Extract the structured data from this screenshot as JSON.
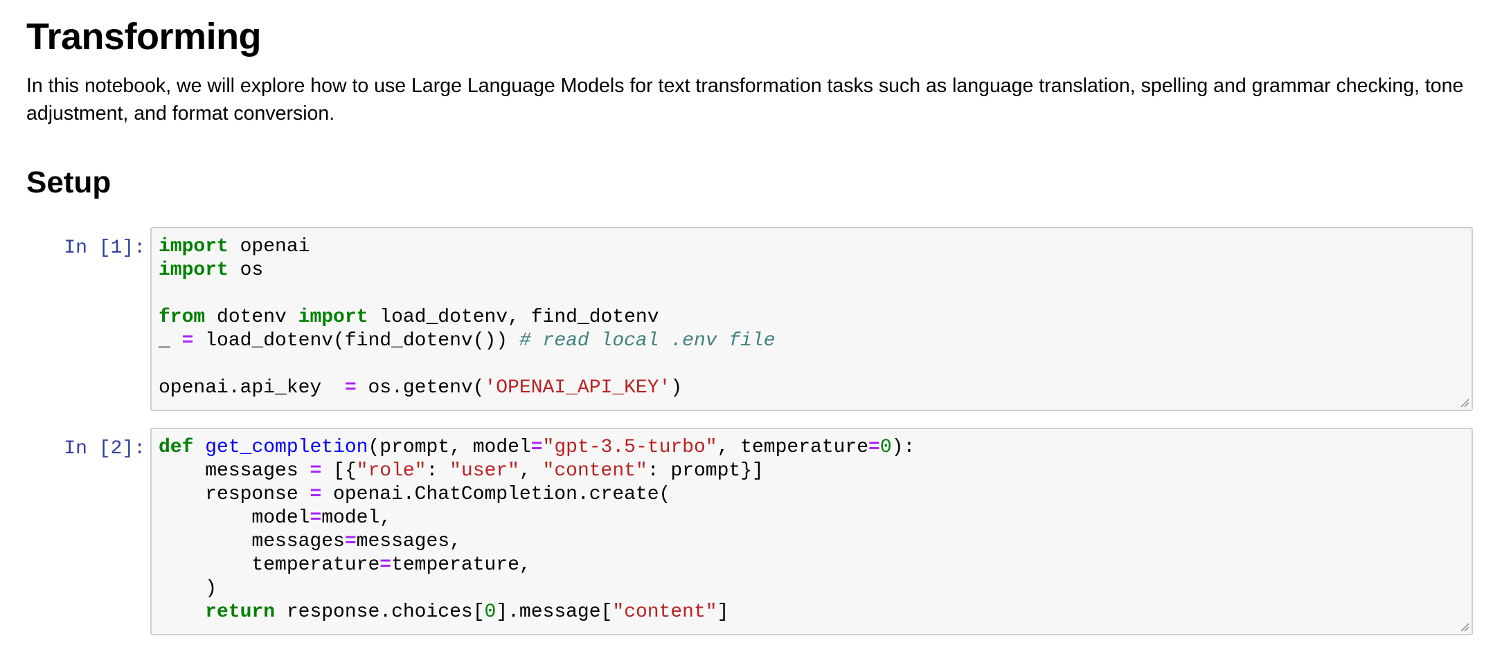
{
  "notebook": {
    "title": "Transforming",
    "intro": "In this notebook, we will explore how to use Large Language Models for text transformation tasks such as language translation, spelling and grammar checking, tone adjustment, and format conversion.",
    "section_heading": "Setup"
  },
  "cells": [
    {
      "prompt": "In [1]:",
      "lines": [
        [
          {
            "t": "import",
            "c": "kw"
          },
          {
            "t": " openai"
          }
        ],
        [
          {
            "t": "import",
            "c": "kw"
          },
          {
            "t": " os"
          }
        ],
        [],
        [
          {
            "t": "from",
            "c": "kw"
          },
          {
            "t": " dotenv "
          },
          {
            "t": "import",
            "c": "kw"
          },
          {
            "t": " load_dotenv, find_dotenv"
          }
        ],
        [
          {
            "t": "_ "
          },
          {
            "t": "=",
            "c": "op"
          },
          {
            "t": " load_dotenv(find_dotenv()) "
          },
          {
            "t": "# read local .env file",
            "c": "cm"
          }
        ],
        [],
        [
          {
            "t": "openai.api_key  "
          },
          {
            "t": "=",
            "c": "op"
          },
          {
            "t": " os.getenv("
          },
          {
            "t": "'OPENAI_API_KEY'",
            "c": "str"
          },
          {
            "t": ")"
          }
        ]
      ]
    },
    {
      "prompt": "In [2]:",
      "lines": [
        [
          {
            "t": "def",
            "c": "kw"
          },
          {
            "t": " "
          },
          {
            "t": "get_completion",
            "c": "fn"
          },
          {
            "t": "(prompt, model"
          },
          {
            "t": "=",
            "c": "op"
          },
          {
            "t": "\"gpt-3.5-turbo\"",
            "c": "str"
          },
          {
            "t": ", temperature"
          },
          {
            "t": "=",
            "c": "op"
          },
          {
            "t": "0",
            "c": "num"
          },
          {
            "t": "):"
          }
        ],
        [
          {
            "t": "    messages "
          },
          {
            "t": "=",
            "c": "op"
          },
          {
            "t": " [{"
          },
          {
            "t": "\"role\"",
            "c": "str"
          },
          {
            "t": ": "
          },
          {
            "t": "\"user\"",
            "c": "str"
          },
          {
            "t": ", "
          },
          {
            "t": "\"content\"",
            "c": "str"
          },
          {
            "t": ": prompt}]"
          }
        ],
        [
          {
            "t": "    response "
          },
          {
            "t": "=",
            "c": "op"
          },
          {
            "t": " openai.ChatCompletion.create("
          }
        ],
        [
          {
            "t": "        model"
          },
          {
            "t": "=",
            "c": "op"
          },
          {
            "t": "model,"
          }
        ],
        [
          {
            "t": "        messages"
          },
          {
            "t": "=",
            "c": "op"
          },
          {
            "t": "messages,"
          }
        ],
        [
          {
            "t": "        temperature"
          },
          {
            "t": "=",
            "c": "op"
          },
          {
            "t": "temperature,"
          }
        ],
        [
          {
            "t": "    )"
          }
        ],
        [
          {
            "t": "    "
          },
          {
            "t": "return",
            "c": "kw"
          },
          {
            "t": " response.choices["
          },
          {
            "t": "0",
            "c": "num"
          },
          {
            "t": "].message["
          },
          {
            "t": "\"content\"",
            "c": "str"
          },
          {
            "t": "]"
          }
        ]
      ]
    }
  ],
  "colors": {
    "prompt": "#303f9f",
    "keyword": "#008000",
    "operator": "#aa22ff",
    "string": "#ba2121",
    "comment": "#408080",
    "function": "#0000ff",
    "cell_background": "#f7f7f7",
    "cell_border": "#cfcfcf"
  },
  "icons": {
    "resize_grip": "resize-grip-icon"
  }
}
